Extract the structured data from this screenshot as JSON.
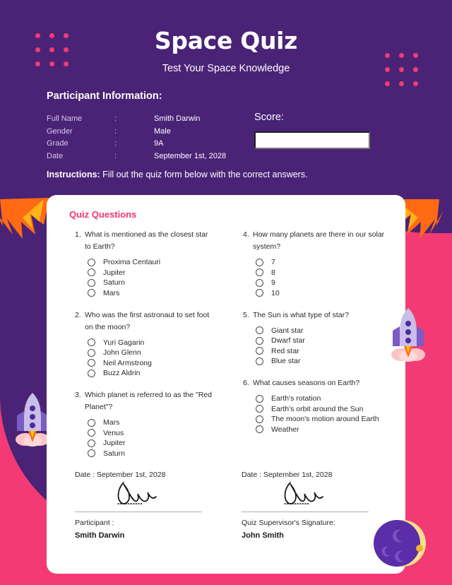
{
  "colors": {
    "purple": "#4A2376",
    "pink": "#F23B74",
    "heading_pink": "#F2317A",
    "white": "#FFFFFF",
    "text_dark": "#2A2A2A",
    "label_lavender": "#D9C9EA"
  },
  "header": {
    "title": "Space Quiz",
    "subtitle": "Test Your Space Knowledge"
  },
  "participant": {
    "section_title": "Participant Information:",
    "rows": [
      {
        "label": "Full Name",
        "colon": ":",
        "value": "Smith Darwin"
      },
      {
        "label": "Gender",
        "colon": ":",
        "value": "Male"
      },
      {
        "label": "Grade",
        "colon": ":",
        "value": "9A"
      },
      {
        "label": "Date",
        "colon": ":",
        "value": "September 1st, 2028"
      }
    ]
  },
  "score": {
    "label": "Score:",
    "value": ""
  },
  "instructions": {
    "lead": "Instructions:",
    "text": " Fill out the quiz form below with the correct answers."
  },
  "card": {
    "title": "Quiz Questions",
    "left_questions": [
      {
        "number": "1.",
        "text": "What is mentioned as the closest star to Earth?",
        "options": [
          "Proxima Centauri",
          "Jupiter",
          "Saturn",
          "Mars"
        ]
      },
      {
        "number": "2.",
        "text": "Who was the first astronaut to set foot on the moon?",
        "options": [
          "Yuri Gagarin",
          "John Glenn",
          "Neil Armstrong",
          "Buzz Aldrin"
        ]
      },
      {
        "number": "3.",
        "text": "Which planet is referred to as the \"Red Planet\"?",
        "options": [
          "Mars",
          "Venus",
          "Jupiter",
          "Saturn"
        ]
      }
    ],
    "right_questions": [
      {
        "number": "4.",
        "text": "How many planets are there in our solar system?",
        "options": [
          "7",
          "8",
          "9",
          "10"
        ]
      },
      {
        "number": "5.",
        "text": "The Sun is what type of star?",
        "options": [
          "Giant star",
          "Dwarf star",
          "Red star",
          "Blue star"
        ]
      },
      {
        "number": "6.",
        "text": "What causes seasons on Earth?",
        "options": [
          "Earth's rotation",
          "Earth's orbit around the Sun",
          "The moon's motion around Earth",
          "Weather"
        ]
      }
    ]
  },
  "signatures": {
    "participant": {
      "date": "Date : September 1st, 2028",
      "role": "Participant :",
      "name": "Smith Darwin"
    },
    "supervisor": {
      "date": "Date : September 1st, 2028",
      "role": "Quiz Supervisor's Signature:",
      "name": "John Smith"
    }
  },
  "decorations": {
    "dots_top_left": "dot-grid-icon",
    "dots_top_right": "dot-grid-icon",
    "flame_left": "flame-icon",
    "flame_right": "flame-icon",
    "rocket_left": "rocket-icon",
    "rocket_right": "rocket-icon",
    "moon": "moon-icon"
  }
}
